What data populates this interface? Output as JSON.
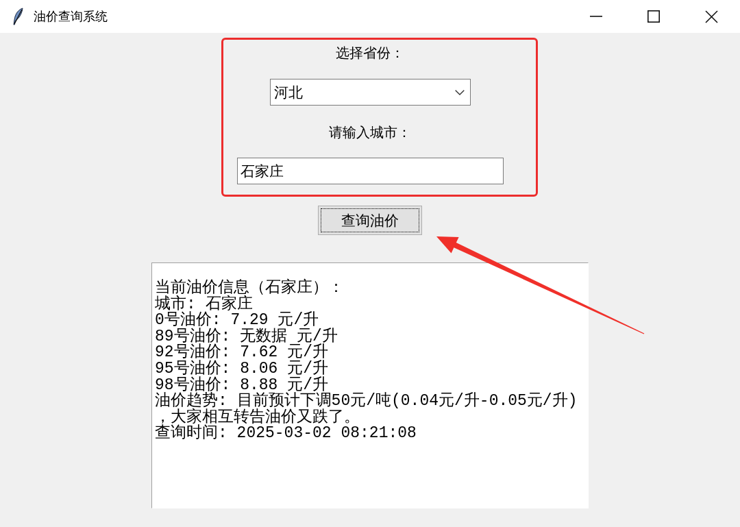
{
  "window": {
    "title": "油价查询系统"
  },
  "form": {
    "province_label": "选择省份：",
    "province": {
      "value": "河北"
    },
    "city_label": "请输入城市：",
    "city": {
      "value": "石家庄"
    },
    "query_button": "查询油价"
  },
  "result": {
    "lines": [
      "当前油价信息（石家庄）：",
      "城市: 石家庄",
      "0号油价: 7.29 元/升",
      "89号油价: 无数据 元/升",
      "92号油价: 7.62 元/升",
      "95号油价: 8.06 元/升",
      "98号油价: 8.88 元/升",
      "油价趋势: 目前预计下调50元/吨(0.04元/升-0.05元/升)",
      "，大家相互转告油价又跌了。",
      "查询时间: 2025-03-02 08:21:08"
    ]
  }
}
